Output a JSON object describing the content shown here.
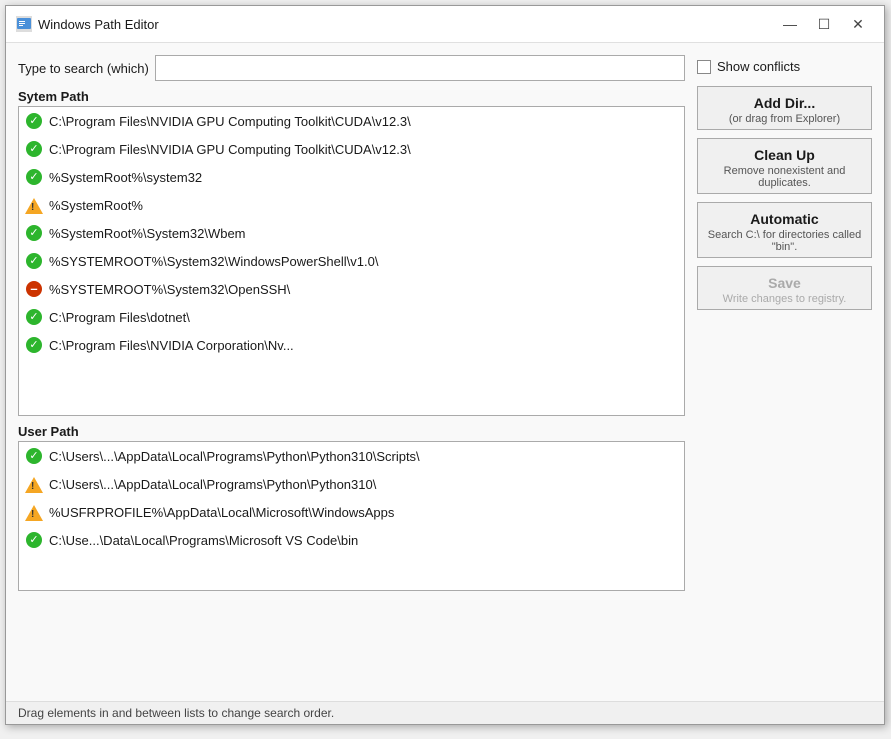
{
  "window": {
    "title": "Windows Path Editor",
    "icon": "window-icon"
  },
  "titlebar": {
    "minimize_label": "—",
    "maximize_label": "☐",
    "close_label": "✕"
  },
  "search": {
    "label": "Type to search (which)",
    "placeholder": "",
    "value": ""
  },
  "system_path": {
    "label": "Sytem Path",
    "items": [
      {
        "status": "ok",
        "text": "C:\\Program Files\\NVIDIA GPU Computing Toolkit\\CUDA\\v12.3\\"
      },
      {
        "status": "ok",
        "text": "C:\\Program Files\\NVIDIA GPU Computing Toolkit\\CUDA\\v12.3\\"
      },
      {
        "status": "ok",
        "text": "%SystemRoot%\\system32"
      },
      {
        "status": "warn",
        "text": "%SystemRoot%"
      },
      {
        "status": "ok",
        "text": "%SystemRoot%\\System32\\Wbem"
      },
      {
        "status": "ok",
        "text": "%SYSTEMROOT%\\System32\\WindowsPowerShell\\v1.0\\"
      },
      {
        "status": "error",
        "text": "%SYSTEMROOT%\\System32\\OpenSSH\\"
      },
      {
        "status": "ok",
        "text": "C:\\Program Files\\dotnet\\"
      },
      {
        "status": "ok",
        "text": "C:\\Program Files\\NVIDIA Corporation\\Nv..."
      }
    ]
  },
  "user_path": {
    "label": "User Path",
    "items": [
      {
        "status": "ok",
        "text": "C:\\Users\\...\\AppData\\Local\\Programs\\Python\\Python310\\Scripts\\"
      },
      {
        "status": "warn",
        "text": "C:\\Users\\...\\AppData\\Local\\Programs\\Python\\Python310\\"
      },
      {
        "status": "warn",
        "text": "%USFRPROFILE%\\AppData\\Local\\Microsoft\\WindowsApps"
      },
      {
        "status": "ok",
        "text": "C:\\Use...\\Data\\Local\\Programs\\Microsoft VS Code\\bin"
      }
    ]
  },
  "right_panel": {
    "show_conflicts": {
      "label": "Show conflicts",
      "checked": false
    },
    "add_dir": {
      "title": "Add Dir...",
      "subtitle": "(or drag from Explorer)"
    },
    "clean_up": {
      "title": "Clean Up",
      "subtitle": "Remove nonexistent and duplicates."
    },
    "automatic": {
      "title": "Automatic",
      "subtitle": "Search C:\\ for directories called \"bin\"."
    },
    "save": {
      "title": "Save",
      "subtitle": "Write changes to registry.",
      "disabled": true
    }
  },
  "status_bar": {
    "text": "Drag elements in and between lists to change search order."
  }
}
